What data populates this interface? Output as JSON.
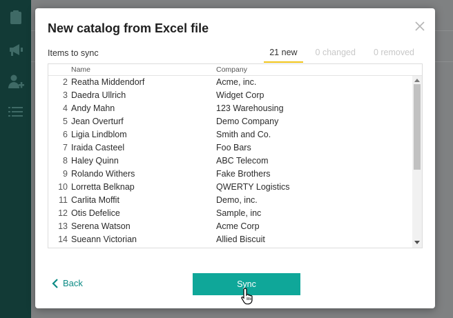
{
  "sidebar": {
    "icons": [
      "clipboard-icon",
      "megaphone-icon",
      "add-user-icon",
      "list-icon"
    ]
  },
  "modal": {
    "title": "New catalog from Excel file",
    "items_label": "Items to sync",
    "tabs": [
      {
        "label": "21 new",
        "active": true
      },
      {
        "label": "0 changed",
        "active": false
      },
      {
        "label": "0 removed",
        "active": false
      }
    ],
    "table": {
      "columns": [
        "Name",
        "Company"
      ],
      "rows": [
        {
          "num": "2",
          "name": "Reatha Middendorf",
          "company": "Acme, inc."
        },
        {
          "num": "3",
          "name": "Daedra Ullrich",
          "company": "Widget Corp"
        },
        {
          "num": "4",
          "name": "Andy Mahn",
          "company": "123 Warehousing"
        },
        {
          "num": "5",
          "name": "Jean Overturf",
          "company": "Demo Company"
        },
        {
          "num": "6",
          "name": "Ligia Lindblom",
          "company": "Smith and Co."
        },
        {
          "num": "7",
          "name": "Iraida Casteel",
          "company": "Foo Bars"
        },
        {
          "num": "8",
          "name": "Haley Quinn",
          "company": "ABC Telecom"
        },
        {
          "num": "9",
          "name": "Rolando Withers",
          "company": "Fake Brothers"
        },
        {
          "num": "10",
          "name": "Lorretta Belknap",
          "company": "QWERTY Logistics"
        },
        {
          "num": "11",
          "name": "Carlita Moffit",
          "company": "Demo, inc."
        },
        {
          "num": "12",
          "name": "Otis Defelice",
          "company": "Sample, inc"
        },
        {
          "num": "13",
          "name": "Serena Watson",
          "company": "Acme Corp"
        },
        {
          "num": "14",
          "name": "Sueann Victorian",
          "company": "Allied Biscuit"
        }
      ]
    },
    "back_label": "Back",
    "sync_label": "Sync"
  },
  "colors": {
    "sidebar": "#123a36",
    "accent": "#0fa799",
    "tab_underline": "#f0c419",
    "back_link": "#0c8b85"
  }
}
